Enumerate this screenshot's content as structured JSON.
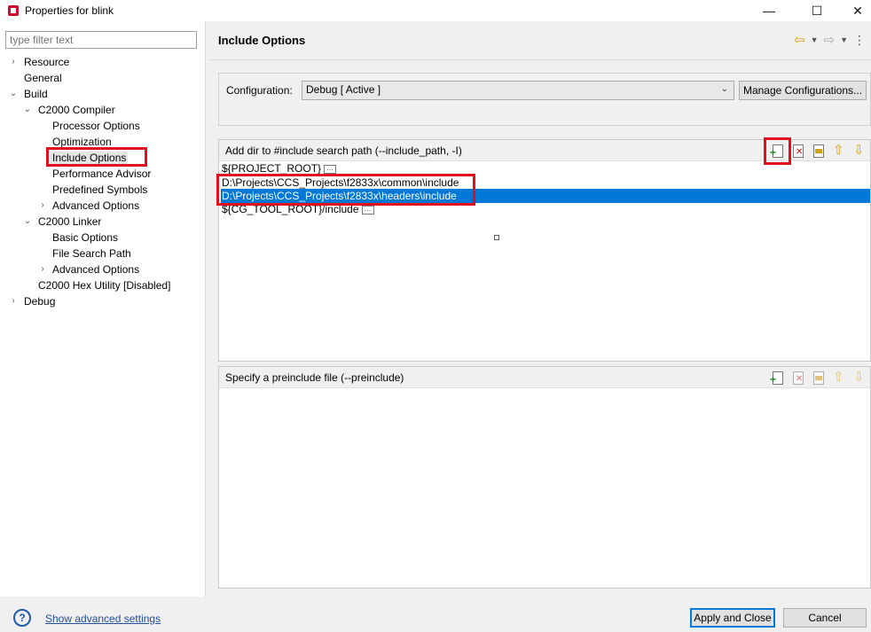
{
  "window": {
    "title": "Properties for blink",
    "minimize": "—",
    "maximize": "☐",
    "close": "✕"
  },
  "filter": {
    "placeholder": "type filter text"
  },
  "tree": {
    "resource": "Resource",
    "general": "General",
    "build": "Build",
    "compiler": "C2000 Compiler",
    "processor_options": "Processor Options",
    "optimization": "Optimization",
    "include_options": "Include Options",
    "performance_advisor": "Performance Advisor",
    "predefined_symbols": "Predefined Symbols",
    "advanced_options_compiler": "Advanced Options",
    "linker": "C2000 Linker",
    "basic_options": "Basic Options",
    "file_search_path": "File Search Path",
    "advanced_options_linker": "Advanced Options",
    "hex_utility": "C2000 Hex Utility  [Disabled]",
    "debug": "Debug"
  },
  "header": {
    "title": "Include Options"
  },
  "configuration": {
    "label": "Configuration:",
    "value": "Debug  [ Active ]",
    "manage_button": "Manage Configurations..."
  },
  "include_paths": {
    "title": "Add dir to #include search path (--include_path, -I)",
    "items": [
      "${PROJECT_ROOT}",
      "D:\\Projects\\CCS_Projects\\f2833x\\common\\include",
      "D:\\Projects\\CCS_Projects\\f2833x\\headers\\include",
      "${CG_TOOL_ROOT}/include"
    ],
    "selected_index": 2
  },
  "preinclude": {
    "title": "Specify a preinclude file (--preinclude)"
  },
  "footer": {
    "advanced_link": "Show advanced settings",
    "apply_close": "Apply and Close",
    "cancel": "Cancel"
  },
  "colors": {
    "selection": "#0078d7",
    "highlight_box": "#e0101e",
    "link": "#1e4fa0"
  }
}
